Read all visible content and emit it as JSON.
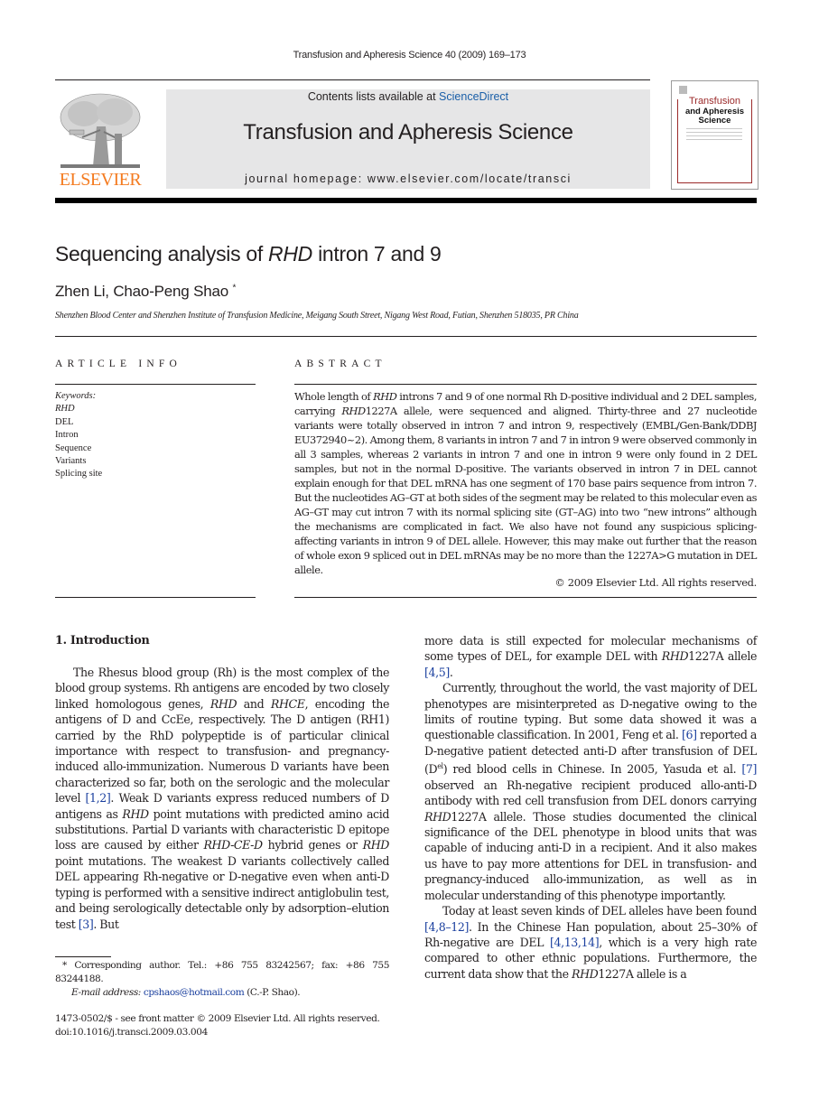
{
  "running_head": "Transfusion and Apheresis Science 40 (2009) 169–173",
  "masthead": {
    "publisher_logo_text": "ELSEVIER",
    "contents_prefix": "Contents lists available at ",
    "contents_link": "ScienceDirect",
    "journal_name": "Transfusion and Apheresis Science",
    "homepage": "journal homepage: www.elsevier.com/locate/transci",
    "cover": {
      "line1": "Transfusion",
      "line2": "and Apheresis",
      "line3": "Science"
    },
    "colors": {
      "elsevier_orange": "#f47b20",
      "link_blue": "#1a5fa8",
      "masthead_gray": "#e6e6e7",
      "cover_red": "#9b2a2a"
    }
  },
  "article": {
    "title_pre": "Sequencing analysis of ",
    "title_italic": "RHD",
    "title_post": " intron 7 and 9",
    "authors": "Zhen Li, Chao-Peng Shao",
    "author_mark": "*",
    "affiliation": "Shenzhen Blood Center and Shenzhen Institute of Transfusion Medicine, Meigang South Street, Nigang West Road, Futian, Shenzhen 518035, PR China"
  },
  "article_info": {
    "heading": "ARTICLE INFO",
    "keywords_label": "Keywords:",
    "keywords": [
      "RHD",
      "DEL",
      "Intron",
      "Sequence",
      "Variants",
      "Splicing site"
    ]
  },
  "abstract": {
    "heading": "ABSTRACT",
    "parts": [
      {
        "t": "Whole length of "
      },
      {
        "t": "RHD",
        "i": true
      },
      {
        "t": " introns 7 and 9 of one normal Rh D-positive individual and 2 DEL samples, carrying "
      },
      {
        "t": "RHD",
        "i": true
      },
      {
        "t": "1227A allele, were sequenced and aligned. Thirty-three and 27 nucleotide variants were totally observed in intron 7 and intron 9, respectively (EMBL/Gen-Bank/DDBJ EU372940~2). Among them, 8 variants in intron 7 and 7 in intron 9 were observed commonly in all 3 samples, whereas 2 variants in intron 7 and one in intron 9 were only found in 2 DEL samples, but not in the normal D-positive. The variants observed in intron 7 in DEL cannot explain enough for that DEL mRNA has one segment of 170 base pairs sequence from intron 7. But the nucleotides AG–GT at both sides of the segment may be related to this molecular even as AG–GT may cut intron 7 with its normal splicing site (GT–AG) into two “new introns” although the mechanisms are complicated in fact. We also have not found any suspicious splicing-affecting variants in intron 9 of DEL allele. However, this may make out further that the reason of whole exon 9 spliced out in DEL mRNAs may be no more than the 1227A>G mutation in DEL allele."
      }
    ],
    "copyright": "© 2009 Elsevier Ltd. All rights reserved."
  },
  "body": {
    "section_heading": "1.  Introduction",
    "left_column": [
      {
        "t": "The Rhesus blood group (Rh) is the most complex of the blood group systems. Rh antigens are encoded by two closely linked homologous genes, "
      },
      {
        "t": "RHD",
        "i": true
      },
      {
        "t": " and "
      },
      {
        "t": "RHCE",
        "i": true
      },
      {
        "t": ", encoding the antigens of D and CcEe, respectively. The D antigen (RH1) carried by the RhD polypeptide is of particular clinical importance with respect to transfusion- and pregnancy-induced allo-immunization. Numerous D variants have been characterized so far, both on the serologic and the molecular level "
      },
      {
        "t": "[1,2]",
        "r": true
      },
      {
        "t": ". Weak D variants express reduced numbers of D antigens as "
      },
      {
        "t": "RHD",
        "i": true
      },
      {
        "t": " point mutations with predicted amino acid substitutions. Partial D variants with characteristic D epitope loss are caused by either "
      },
      {
        "t": "RHD-CE-D",
        "i": true
      },
      {
        "t": " hybrid genes or "
      },
      {
        "t": "RHD",
        "i": true
      },
      {
        "t": " point mutations. The weakest D variants collectively called DEL appearing Rh-negative or D-negative even when anti-D typing is performed with a sensitive indirect antiglobulin test, and being serologically detectable only by adsorption–elution test "
      },
      {
        "t": "[3]",
        "r": true
      },
      {
        "t": ". But"
      }
    ],
    "right_paragraphs": [
      [
        {
          "t": "more data is still expected for molecular mechanisms of some types of DEL, for example DEL with "
        },
        {
          "t": "RHD",
          "i": true
        },
        {
          "t": "1227A allele "
        },
        {
          "t": "[4,5]",
          "r": true
        },
        {
          "t": "."
        }
      ],
      [
        {
          "t": "Currently, throughout the world, the vast majority of DEL phenotypes are misinterpreted as D-negative owing to the limits of routine typing. But some data showed it was a questionable classification. In 2001, Feng et al. "
        },
        {
          "t": "[6]",
          "r": true
        },
        {
          "t": " reported a D-negative patient detected anti-D after transfusion of DEL (D"
        },
        {
          "t": "el",
          "s": true
        },
        {
          "t": ") red blood cells in Chinese. In 2005, Yasuda et al. "
        },
        {
          "t": "[7]",
          "r": true
        },
        {
          "t": " observed an Rh-negative recipient produced allo-anti-D antibody with red cell transfusion from DEL donors carrying "
        },
        {
          "t": "RHD",
          "i": true
        },
        {
          "t": "1227A allele. Those studies documented the clinical significance of the DEL phenotype in blood units that was capable of inducing anti-D in a recipient. And it also makes us have to pay more attentions for DEL in transfusion- and pregnancy-induced allo-immunization, as well as in molecular understanding of this phenotype importantly."
        }
      ],
      [
        {
          "t": "Today at least seven kinds of DEL alleles have been found "
        },
        {
          "t": "[4,8–12]",
          "r": true
        },
        {
          "t": ". In the Chinese Han population, about 25–30% of Rh-negative are DEL "
        },
        {
          "t": "[4,13,14]",
          "r": true
        },
        {
          "t": ", which is a very high rate compared to other ethnic populations. Furthermore, the current data show that the "
        },
        {
          "t": "RHD",
          "i": true
        },
        {
          "t": "1227A allele is a"
        }
      ]
    ]
  },
  "footnote": {
    "marker": "*",
    "text": " Corresponding author. Tel.: +86 755 83242567; fax: +86 755 83244188.",
    "email_label": "E-mail address:",
    "email": "cpshaos@hotmail.com",
    "email_suffix": " (C.-P. Shao)."
  },
  "front_matter": {
    "issn_line": "1473-0502/$ - see front matter © 2009 Elsevier Ltd. All rights reserved.",
    "doi": "doi:10.1016/j.transci.2009.03.004"
  }
}
